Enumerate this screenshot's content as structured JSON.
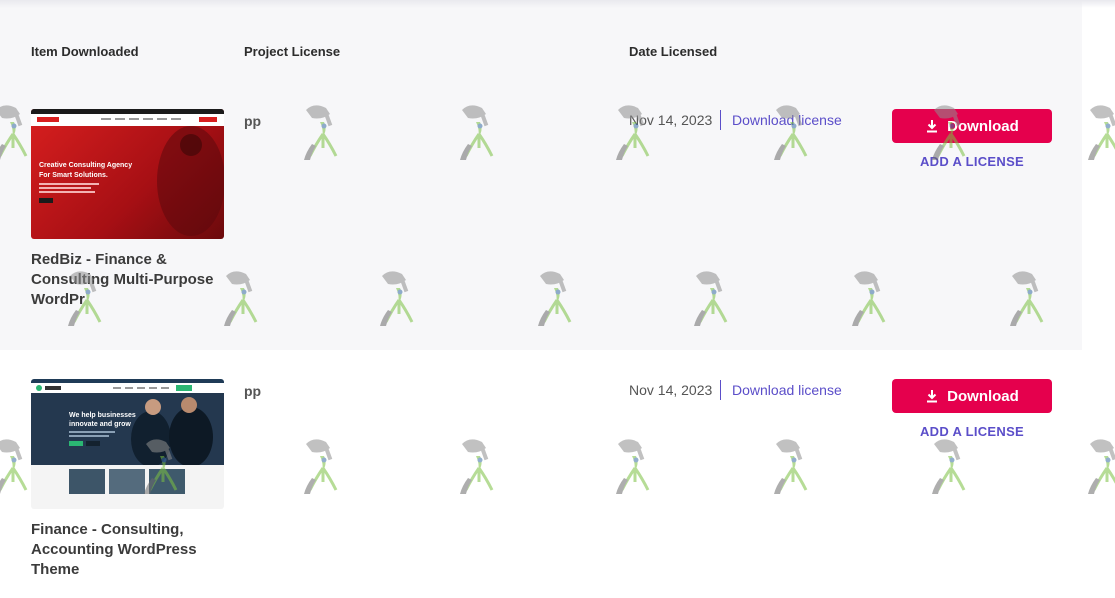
{
  "headers": {
    "item": "Item Downloaded",
    "license": "Project License",
    "date": "Date Licensed"
  },
  "rows": [
    {
      "title": "RedBiz - Finance & Consulting Multi-Purpose WordPr",
      "license": "pp",
      "date": "Nov 14, 2023",
      "download_license": "Download license",
      "download_button": "Download",
      "add_license": "ADD A LICENSE",
      "thumb_headline_1": "Creative Consulting Agency",
      "thumb_headline_2": "For Smart Solutions."
    },
    {
      "title": "Finance - Consulting, Accounting WordPress Theme",
      "license": "pp",
      "date": "Nov 14, 2023",
      "download_license": "Download license",
      "download_button": "Download",
      "add_license": "ADD A LICENSE",
      "thumb_headline_1": "We help businesses",
      "thumb_headline_2": "innovate and grow"
    }
  ],
  "colors": {
    "accent": "#e5004d",
    "link": "#5b4ec9"
  },
  "icons": {
    "download": "download-icon",
    "watermark": "watering-can-watermark-icon"
  }
}
